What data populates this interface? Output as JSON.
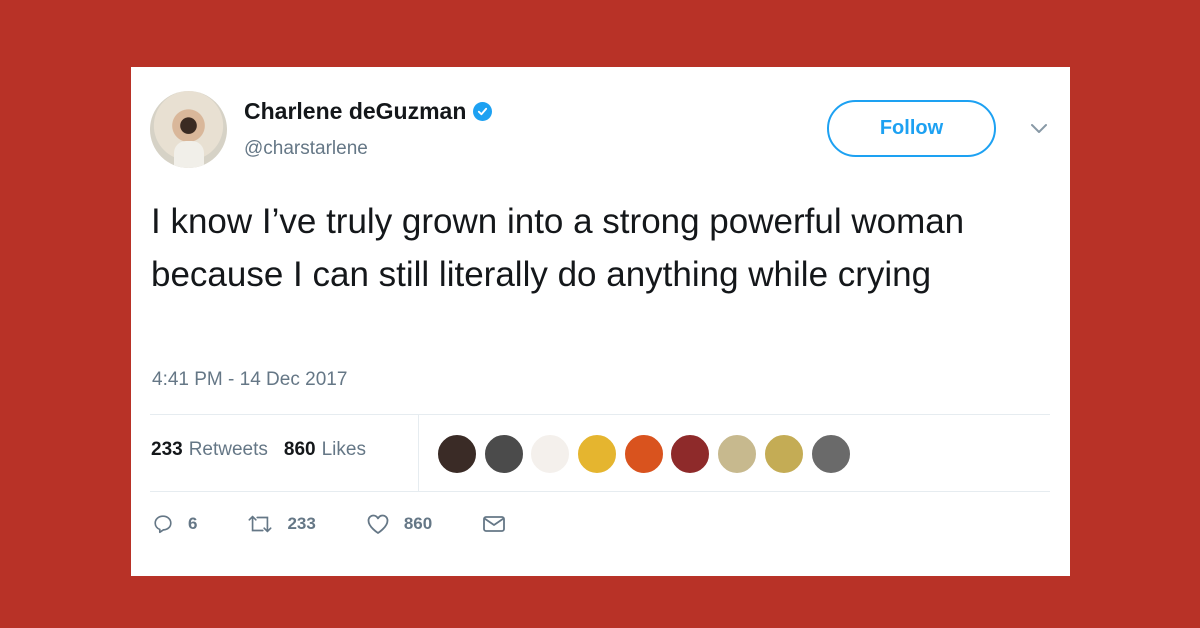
{
  "tweet": {
    "author_name": "Charlene deGuzman",
    "handle": "@charstarlene",
    "follow_label": "Follow",
    "text": "I know I’ve truly grown into a strong powerful woman because I can still literally do anything while crying",
    "timestamp": "4:41 PM - 14 Dec 2017",
    "stats": {
      "retweets_count": "233",
      "retweets_label": "Retweets",
      "likes_count": "860",
      "likes_label": "Likes"
    },
    "likers": [
      {
        "name": "liker-avatar-1",
        "color": "#3a2b26"
      },
      {
        "name": "liker-avatar-2",
        "color": "#4b4b4b"
      },
      {
        "name": "liker-avatar-3",
        "color": "#f4f0ec"
      },
      {
        "name": "liker-avatar-4",
        "color": "#e5b52f"
      },
      {
        "name": "liker-avatar-5",
        "color": "#d9531e"
      },
      {
        "name": "liker-avatar-6",
        "color": "#8e2a2a"
      },
      {
        "name": "liker-avatar-7",
        "color": "#c7b98e"
      },
      {
        "name": "liker-avatar-8",
        "color": "#c4ac55"
      },
      {
        "name": "liker-avatar-9",
        "color": "#6a6a6a"
      }
    ],
    "actions": {
      "replies": "6",
      "retweets": "233",
      "likes": "860"
    }
  },
  "colors": {
    "background": "#b83227",
    "accent": "#1da1f2",
    "text_primary": "#14171a",
    "text_secondary": "#657786"
  },
  "icons": [
    "verified-badge-icon",
    "chevron-down-icon",
    "reply-icon",
    "retweet-icon",
    "like-heart-icon",
    "direct-message-icon"
  ]
}
